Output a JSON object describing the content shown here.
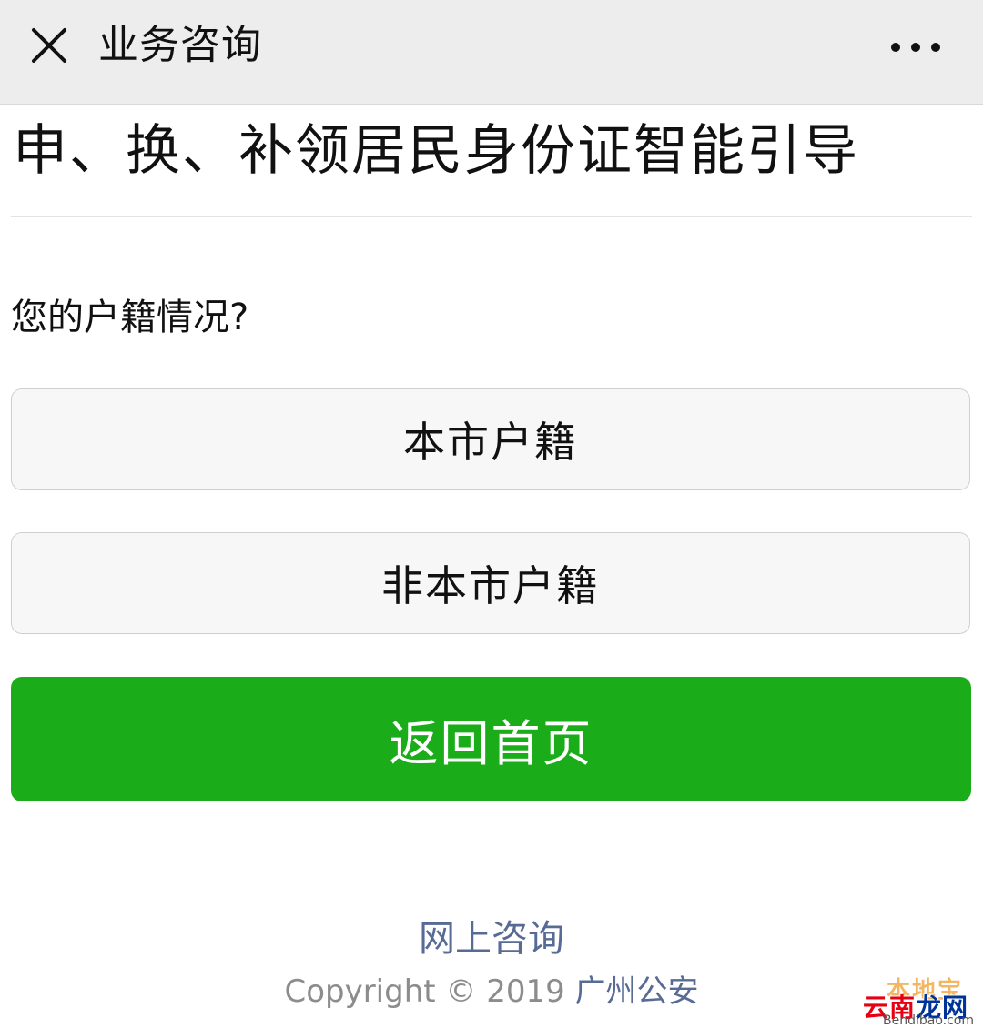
{
  "topbar": {
    "title": "业务咨询",
    "close_icon": "close-icon",
    "more_icon": "more-horizontal-icon"
  },
  "page": {
    "title": "申、换、补领居民身份证智能引导",
    "question": "您的户籍情况?"
  },
  "options": [
    {
      "label": "本市户籍"
    },
    {
      "label": "非本市户籍"
    }
  ],
  "home_button": {
    "label": "返回首页",
    "color": "#1aad19"
  },
  "footer": {
    "link": "网上咨询",
    "copyright": "Copyright © 2019",
    "org": "广州公安",
    "link_color": "#576b95"
  },
  "watermark": {
    "top": "本地宝",
    "main_a": "云南",
    "main_b": "龙网",
    "sub": "Bendibao.com"
  }
}
